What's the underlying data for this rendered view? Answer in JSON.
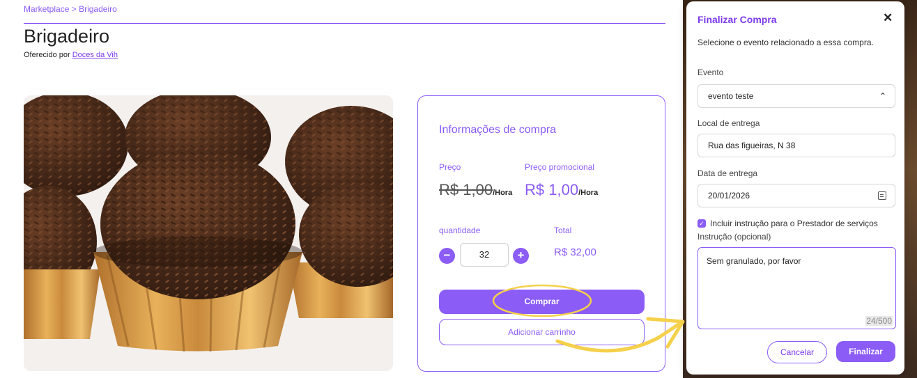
{
  "breadcrumb": {
    "root": "Marketplace",
    "separator": ">",
    "current": "Brigadeiro"
  },
  "product": {
    "title": "Brigadeiro",
    "offered_prefix": "Oferecido por",
    "seller": "Doces da Vih"
  },
  "purchase_card": {
    "title": "Informações de compra",
    "price_label": "Preço",
    "promo_label": "Preço promocional",
    "old_price": "R$ 1,00",
    "promo_price": "R$ 1,00",
    "unit": "/Hora",
    "quantity_label": "quantidade",
    "total_label": "Total",
    "quantity": "32",
    "total": "R$ 32,00",
    "buy_label": "Comprar",
    "cart_label": "Adicionar carrinho"
  },
  "modal": {
    "title": "Finalizar Compra",
    "close": "✕",
    "subtitle": "Selecione o evento relacionado a essa compra.",
    "event_label": "Evento",
    "event_value": "evento teste",
    "location_label": "Local de entrega",
    "location_value": "Rua das figueiras, N 38",
    "date_label": "Data de entrega",
    "date_value": "20/01/2026",
    "include_instruction_label": "Incluir instrução para o Prestador de serviços",
    "include_instruction_checked": true,
    "instruction_label": "Instrução (opcional)",
    "instruction_value": "Sem granulado, por favor",
    "instruction_counter": "24/500",
    "cancel_label": "Cancelar",
    "finish_label": "Finalizar"
  },
  "colors": {
    "accent": "#8b5cf6",
    "annotation": "#f5d04a"
  },
  "icons": {
    "close": "close-icon",
    "chevron": "chevron-up-icon",
    "calendar": "calendar-icon",
    "minus": "minus-icon",
    "plus": "plus-icon"
  }
}
